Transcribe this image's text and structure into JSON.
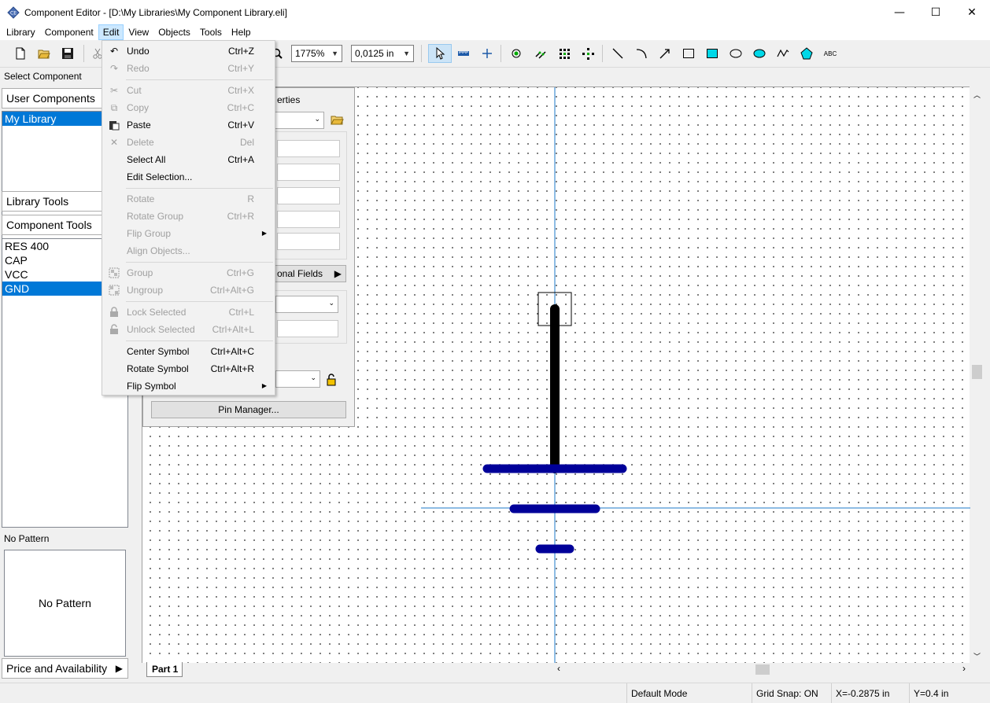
{
  "window": {
    "title": "Component Editor - [D:\\My Libraries\\My Component Library.eli]",
    "minimize": "—",
    "maximize": "☐",
    "close": "✕"
  },
  "menubar": [
    "Library",
    "Component",
    "Edit",
    "View",
    "Objects",
    "Tools",
    "Help"
  ],
  "toolbar": {
    "zoom": "1775%",
    "grid": "0,0125 in"
  },
  "left_panel": {
    "select_caption": "Select Component",
    "user_components": "User Components",
    "libraries": [
      "My Library"
    ],
    "library_tools": "Library Tools",
    "component_tools": "Component Tools",
    "components": [
      "RES 400",
      "CAP",
      "VCC",
      "GND"
    ],
    "selected_component": "GND",
    "pattern_caption": "No Pattern",
    "pattern_preview": "No Pattern",
    "price_availability": "Price and Availability"
  },
  "props": {
    "title": "erties",
    "additional_fields": "onal Fields",
    "pin_manager": "Pin Manager..."
  },
  "edit_menu": [
    {
      "label": "Undo",
      "shortcut": "Ctrl+Z",
      "enabled": true,
      "icon": "undo-icon"
    },
    {
      "label": "Redo",
      "shortcut": "Ctrl+Y",
      "enabled": false,
      "icon": "redo-icon"
    },
    {
      "label": "Cut",
      "shortcut": "Ctrl+X",
      "enabled": false,
      "icon": "scissors-icon"
    },
    {
      "label": "Copy",
      "shortcut": "Ctrl+C",
      "enabled": false,
      "icon": "copy-icon"
    },
    {
      "label": "Paste",
      "shortcut": "Ctrl+V",
      "enabled": true,
      "icon": "paste-icon"
    },
    {
      "label": "Delete",
      "shortcut": "Del",
      "enabled": false,
      "icon": "delete-icon"
    },
    {
      "label": "Select All",
      "shortcut": "Ctrl+A",
      "enabled": true
    },
    {
      "label": "Edit Selection...",
      "shortcut": "",
      "enabled": true
    },
    {
      "label": "Rotate",
      "shortcut": "R",
      "enabled": false
    },
    {
      "label": "Rotate Group",
      "shortcut": "Ctrl+R",
      "enabled": false
    },
    {
      "label": "Flip Group",
      "shortcut": "",
      "enabled": false,
      "submenu": true
    },
    {
      "label": "Align Objects...",
      "shortcut": "",
      "enabled": false
    },
    {
      "label": "Group",
      "shortcut": "Ctrl+G",
      "enabled": false,
      "icon": "group-icon"
    },
    {
      "label": "Ungroup",
      "shortcut": "Ctrl+Alt+G",
      "enabled": false,
      "icon": "ungroup-icon"
    },
    {
      "label": "Lock Selected",
      "shortcut": "Ctrl+L",
      "enabled": false,
      "icon": "lock-icon"
    },
    {
      "label": "Unlock Selected",
      "shortcut": "Ctrl+Alt+L",
      "enabled": false,
      "icon": "unlock-icon"
    },
    {
      "label": "Center Symbol",
      "shortcut": "Ctrl+Alt+C",
      "enabled": true
    },
    {
      "label": "Rotate Symbol",
      "shortcut": "Ctrl+Alt+R",
      "enabled": true
    },
    {
      "label": "Flip Symbol",
      "shortcut": "",
      "enabled": true,
      "submenu": true
    }
  ],
  "canvas": {
    "part_tab": "Part 1",
    "symbol_color": "#000099",
    "pin_color": "#000000",
    "crosshair_color": "#1e78c8"
  },
  "status": {
    "mode": "Default Mode",
    "grid_snap": "Grid Snap: ON",
    "x": "X=-0.2875 in",
    "y": "Y=0.4 in"
  }
}
